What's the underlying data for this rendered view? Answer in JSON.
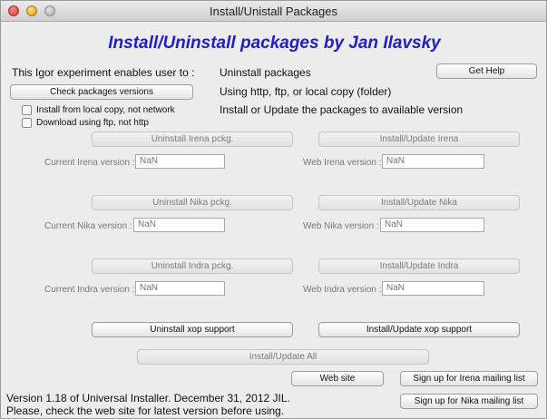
{
  "window": {
    "title": "Install/Unistall Packages"
  },
  "heading": "Install/Uninstall packages by Jan Ilavsky",
  "intro": {
    "enables": "This Igor experiment enables user to :",
    "features": [
      "Uninstall packages",
      "Using http, ftp, or local copy (folder)",
      "Install or Update the packages to available version"
    ]
  },
  "buttons": {
    "get_help": "Get Help",
    "check_versions": "Check packages versions",
    "uninstall_irena": "Uninstall Irena pckg.",
    "install_irena": "Install/Update Irena",
    "uninstall_nika": "Uninstall Nika pckg.",
    "install_nika": "Install/Update Nika",
    "uninstall_indra": "Uninstall Indra pckg.",
    "install_indra": "Install/Update Indra",
    "uninstall_xop": "Uninstall xop support",
    "install_xop": "Install/Update xop support",
    "install_all": "Install/Update All",
    "web_site": "Web site",
    "signup_irena": "Sign up for Irena mailing list",
    "signup_nika": "Sign up for Nika mailing list"
  },
  "options": {
    "local_copy": "Install from local copy, not network",
    "ftp": "Download using ftp, not http"
  },
  "versions": {
    "current_irena_label": "Current Irena version :",
    "current_irena_value": "NaN",
    "web_irena_label": "Web Irena version :",
    "web_irena_value": "NaN",
    "current_nika_label": "Current Nika version :",
    "current_nika_value": "NaN",
    "web_nika_label": "Web Nika version :",
    "web_nika_value": "NaN",
    "current_indra_label": "Current Indra version :",
    "current_indra_value": "NaN",
    "web_indra_label": "Web Indra version :",
    "web_indra_value": "NaN"
  },
  "footer": {
    "line1": "Version 1.18 of Universal Installer. December 31, 2012 JIL.",
    "line2": "Please, check the web site for latest version before using."
  }
}
